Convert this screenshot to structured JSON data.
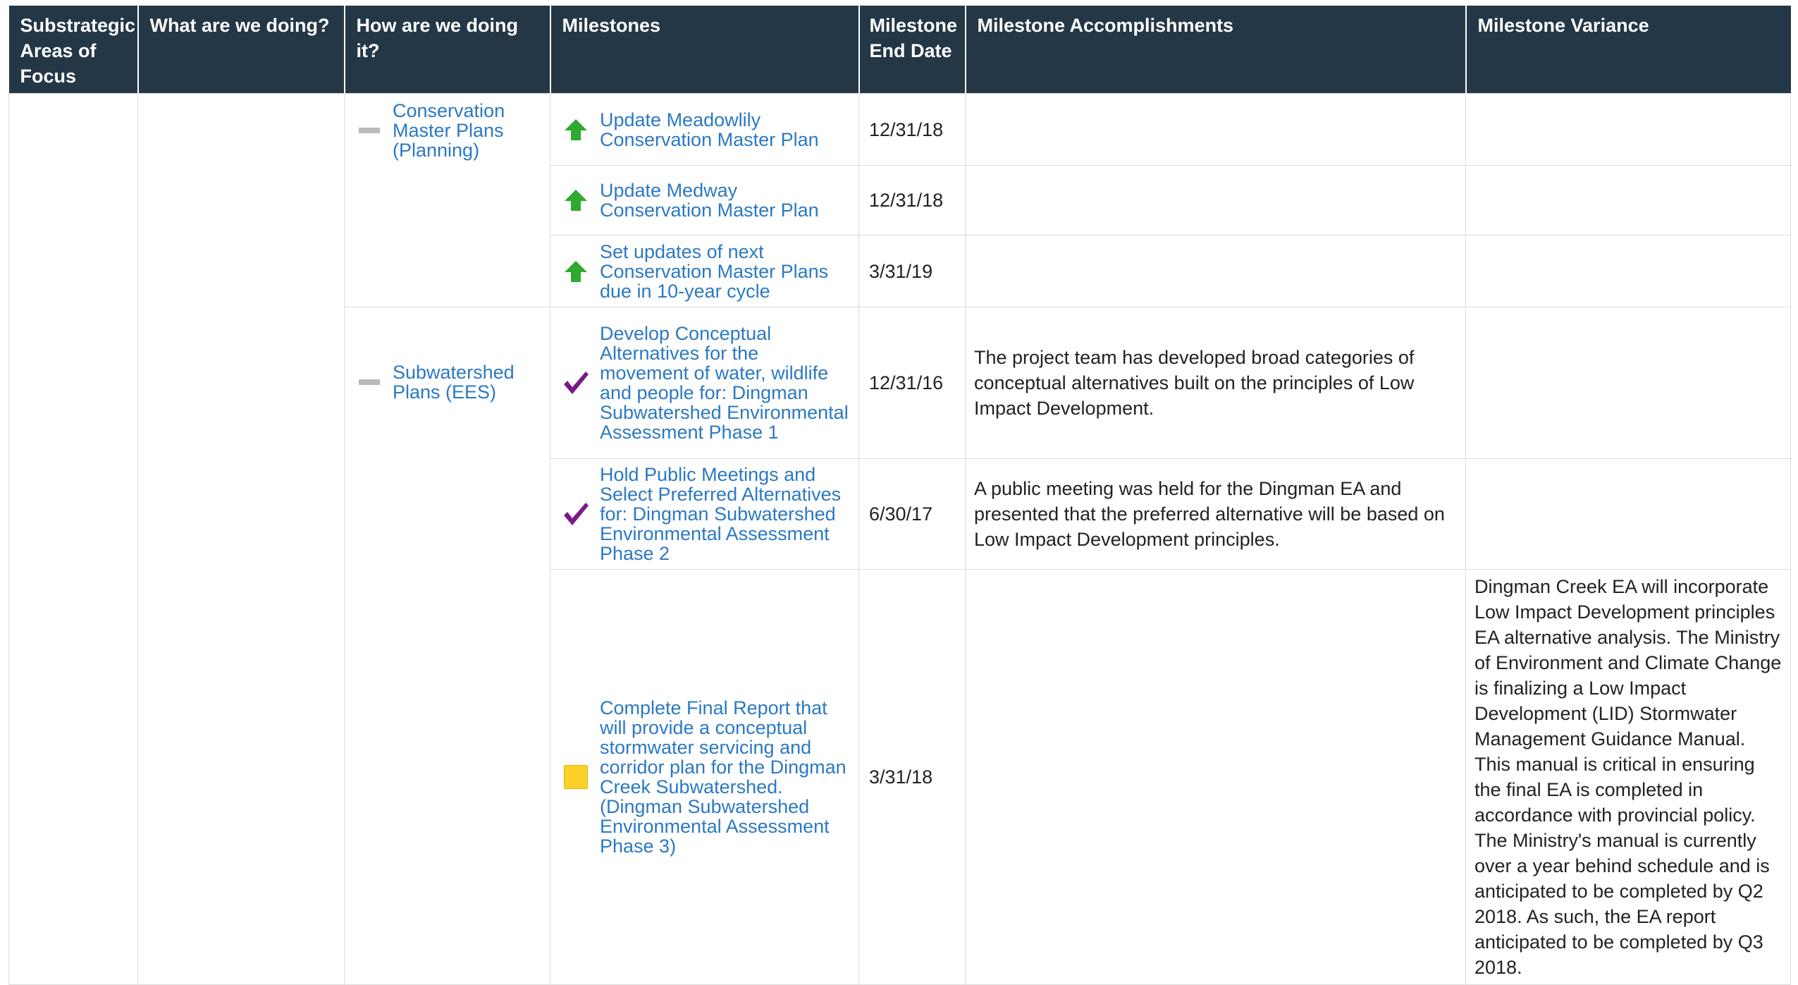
{
  "headers": {
    "substrategic": "Substrategic Areas of Focus",
    "what": "What are we doing?",
    "how": "How are we doing it?",
    "milestones": "Milestones",
    "end_date": "Milestone End Date",
    "accomplishments": "Milestone Accomplishments",
    "variance": "Milestone Variance"
  },
  "groups": [
    {
      "how": "Conservation Master Plans (Planning)",
      "how_icon": "dash-icon",
      "milestones": [
        {
          "name": "Update Meadowlily Conservation Master Plan",
          "status_icon": "up-arrow-icon",
          "end_date": "12/31/18",
          "accomplishment": "",
          "variance": ""
        },
        {
          "name": "Update Medway Conservation Master Plan",
          "status_icon": "up-arrow-icon",
          "end_date": "12/31/18",
          "accomplishment": "",
          "variance": ""
        },
        {
          "name": "Set updates of next Conservation Master Plans due in 10-year cycle",
          "status_icon": "up-arrow-icon",
          "end_date": "3/31/19",
          "accomplishment": "",
          "variance": ""
        }
      ]
    },
    {
      "how": "Subwatershed Plans (EES)",
      "how_icon": "dash-icon",
      "milestones": [
        {
          "name": "Develop Conceptual Alternatives for the movement of water, wildlife and people for: Dingman Subwatershed Environmental Assessment Phase 1",
          "status_icon": "checkmark-icon",
          "end_date": "12/31/16",
          "accomplishment": "The project team has developed broad categories of conceptual alternatives built on the principles of Low Impact Development.",
          "variance": ""
        },
        {
          "name": "Hold Public Meetings and Select Preferred Alternatives for: Dingman Subwatershed Environmental Assessment Phase 2",
          "status_icon": "checkmark-icon",
          "end_date": "6/30/17",
          "accomplishment": "A public meeting was held for the Dingman EA and presented that the preferred alternative will be based on Low Impact Development principles.",
          "variance": ""
        },
        {
          "name": "Complete Final Report that will provide a conceptual stormwater servicing and corridor plan for the Dingman Creek Subwatershed. (Dingman Subwatershed Environmental Assessment Phase 3)",
          "status_icon": "yellow-square-icon",
          "end_date": "3/31/18",
          "accomplishment": "",
          "variance": "Dingman Creek EA will incorporate Low Impact Development principles EA alternative analysis. The Ministry of Environment and Climate Change is finalizing a Low Impact Development (LID) Stormwater Management Guidance Manual. This manual is critical in ensuring the final EA is completed in accordance with provincial policy. The Ministry's manual is currently over a year behind schedule and is anticipated to be completed by Q2 2018. As such, the EA report anticipated to be completed by Q3 2018."
        }
      ]
    }
  ],
  "colors": {
    "header_bg": "#243746",
    "link": "#2b79c2",
    "up_arrow": "#2eaa2e",
    "checkmark": "#7b1a86",
    "yellow_square": "#fcd12a"
  }
}
